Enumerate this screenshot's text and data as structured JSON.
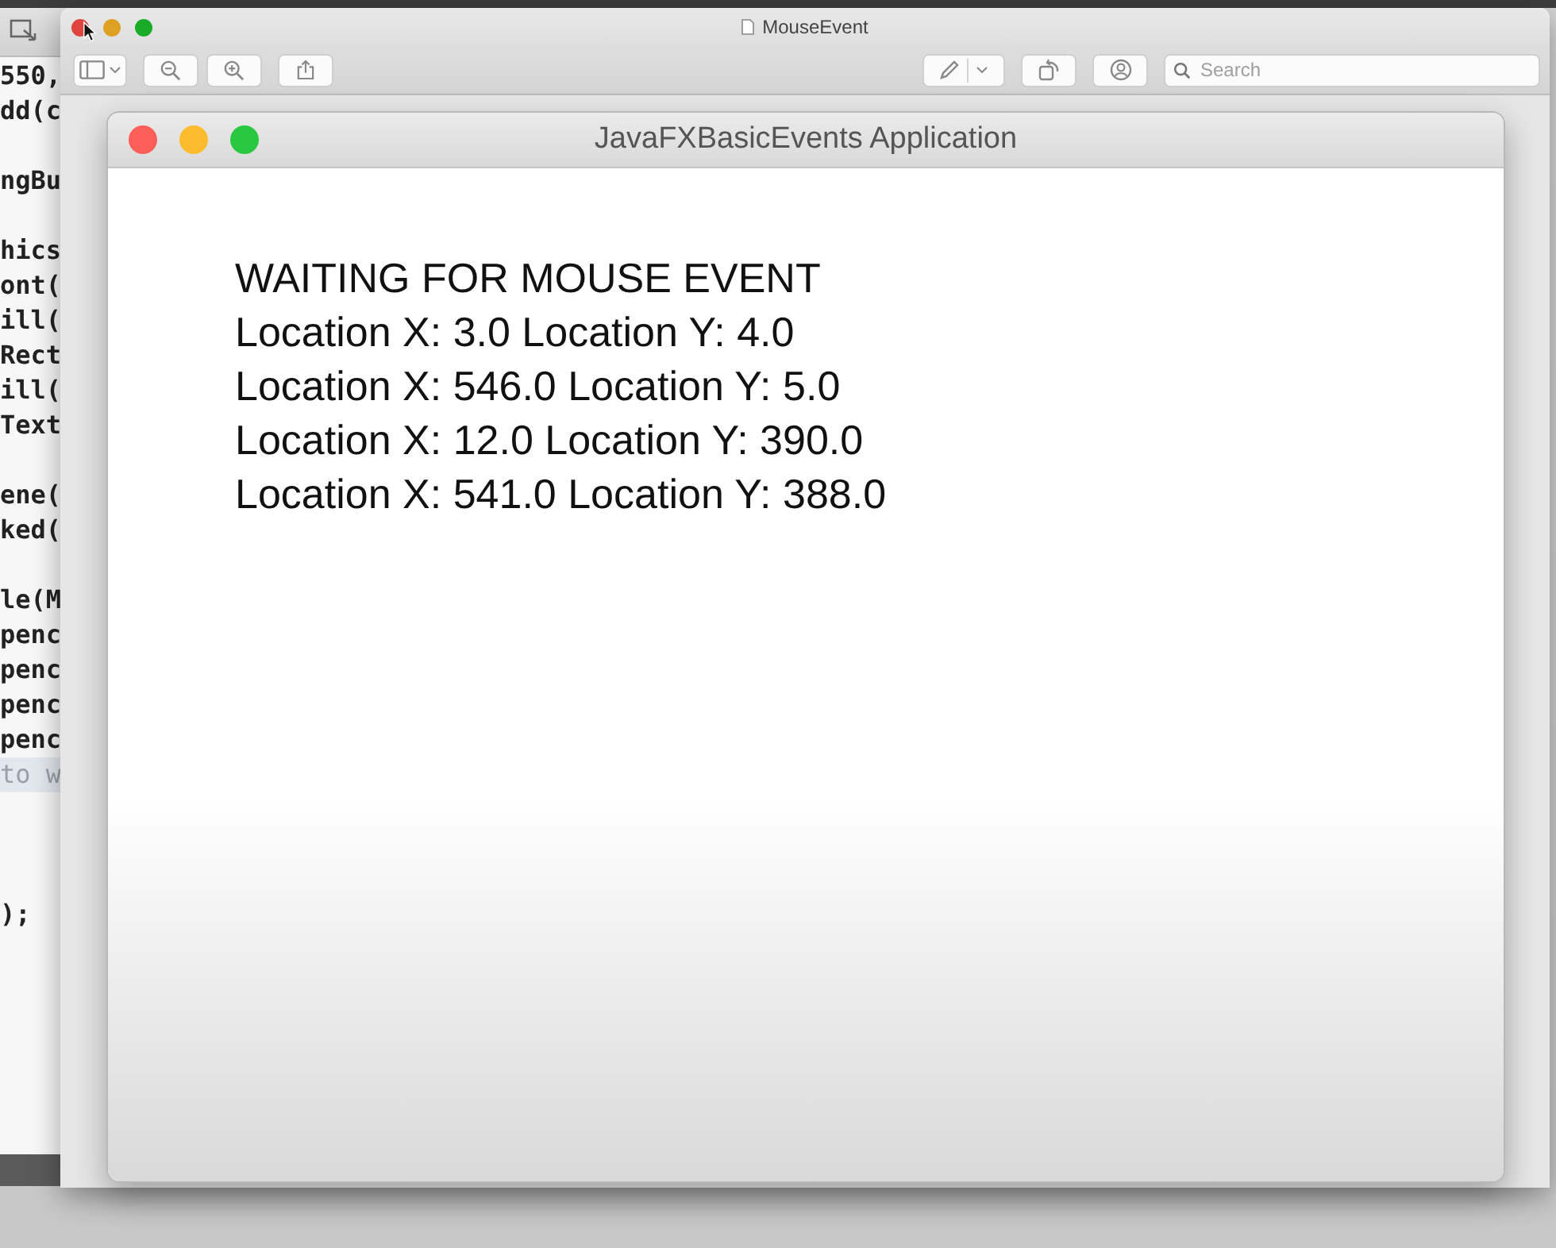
{
  "code_editor": {
    "lines": [
      {
        "kind": "code",
        "text": "550,"
      },
      {
        "kind": "code",
        "text": "dd(c"
      },
      {
        "kind": "blank"
      },
      {
        "kind": "code",
        "text": "ngBu"
      },
      {
        "kind": "blank"
      },
      {
        "kind": "code",
        "text": "hics"
      },
      {
        "kind": "code",
        "text": "ont("
      },
      {
        "kind": "code",
        "text": "ill("
      },
      {
        "kind": "code",
        "text": "Rect"
      },
      {
        "kind": "code",
        "text": "ill("
      },
      {
        "kind": "code",
        "text": "Text"
      },
      {
        "kind": "blank"
      },
      {
        "kind": "code",
        "text": "ene("
      },
      {
        "kind": "code",
        "text": "ked("
      },
      {
        "kind": "blank"
      },
      {
        "kind": "code",
        "text": "le(M"
      },
      {
        "kind": "code",
        "text": "penc"
      },
      {
        "kind": "code",
        "text": "penc"
      },
      {
        "kind": "code",
        "text": "penc"
      },
      {
        "kind": "code",
        "text": "penc"
      },
      {
        "kind": "comment",
        "text": "to w"
      },
      {
        "kind": "blank"
      },
      {
        "kind": "blank"
      },
      {
        "kind": "blank"
      },
      {
        "kind": "code",
        "text": ");"
      }
    ]
  },
  "preview_window": {
    "title": "MouseEvent",
    "search": {
      "placeholder": "Search"
    }
  },
  "app_window": {
    "title": "JavaFXBasicEvents Application",
    "lines": [
      "WAITING FOR MOUSE EVENT",
      "Location X: 3.0 Location Y: 4.0",
      "Location X: 546.0 Location Y: 5.0",
      "Location X: 12.0 Location Y: 390.0",
      "Location X: 541.0 Location Y: 388.0"
    ]
  }
}
